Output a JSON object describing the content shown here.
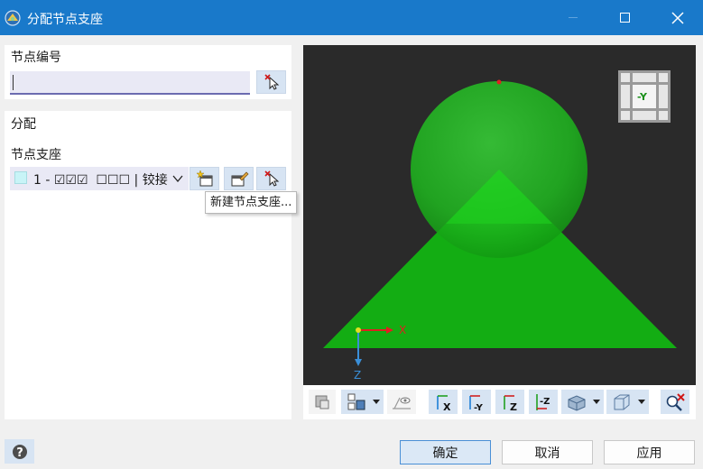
{
  "window": {
    "title": "分配节点支座"
  },
  "node_section": {
    "label": "节点编号",
    "input_value": ""
  },
  "assign_section": {
    "label": "分配",
    "support_label": "节点支座",
    "support_select": {
      "prefix": "1 - ",
      "checks_a": "☑☑☑",
      "checks_b": "☐☐☐",
      "suffix": " | 铰接"
    },
    "tooltip": "新建节点支座..."
  },
  "viewport": {
    "view_cube_label": "-Y",
    "axis_x_label": "X",
    "axis_z_label": "Z",
    "colors": {
      "background": "#2a2a2a",
      "support_green": "#14b414",
      "sphere_green": "#22c022"
    }
  },
  "view_toolbar": {
    "buttons": [
      {
        "icon": "display-options-icon"
      },
      {
        "icon": "view-settings-icon",
        "dropdown": true
      },
      {
        "icon": "render-mode-icon"
      },
      {
        "icon": "view-x-icon",
        "label": "X"
      },
      {
        "icon": "view-minus-y-icon",
        "label": "-Y"
      },
      {
        "icon": "view-z-icon",
        "label": "Z"
      },
      {
        "icon": "view-minus-z-icon",
        "label": "-Z"
      },
      {
        "icon": "isometric-view-icon",
        "dropdown": true
      },
      {
        "icon": "wireframe-box-icon",
        "dropdown": true
      },
      {
        "icon": "reset-zoom-icon"
      }
    ]
  },
  "footer": {
    "ok": "确定",
    "cancel": "取消",
    "apply": "应用"
  },
  "theme": {
    "titlebar": "#1979ca",
    "button_blue": "#d7e4f3",
    "input_bg": "#e9e9f5"
  }
}
